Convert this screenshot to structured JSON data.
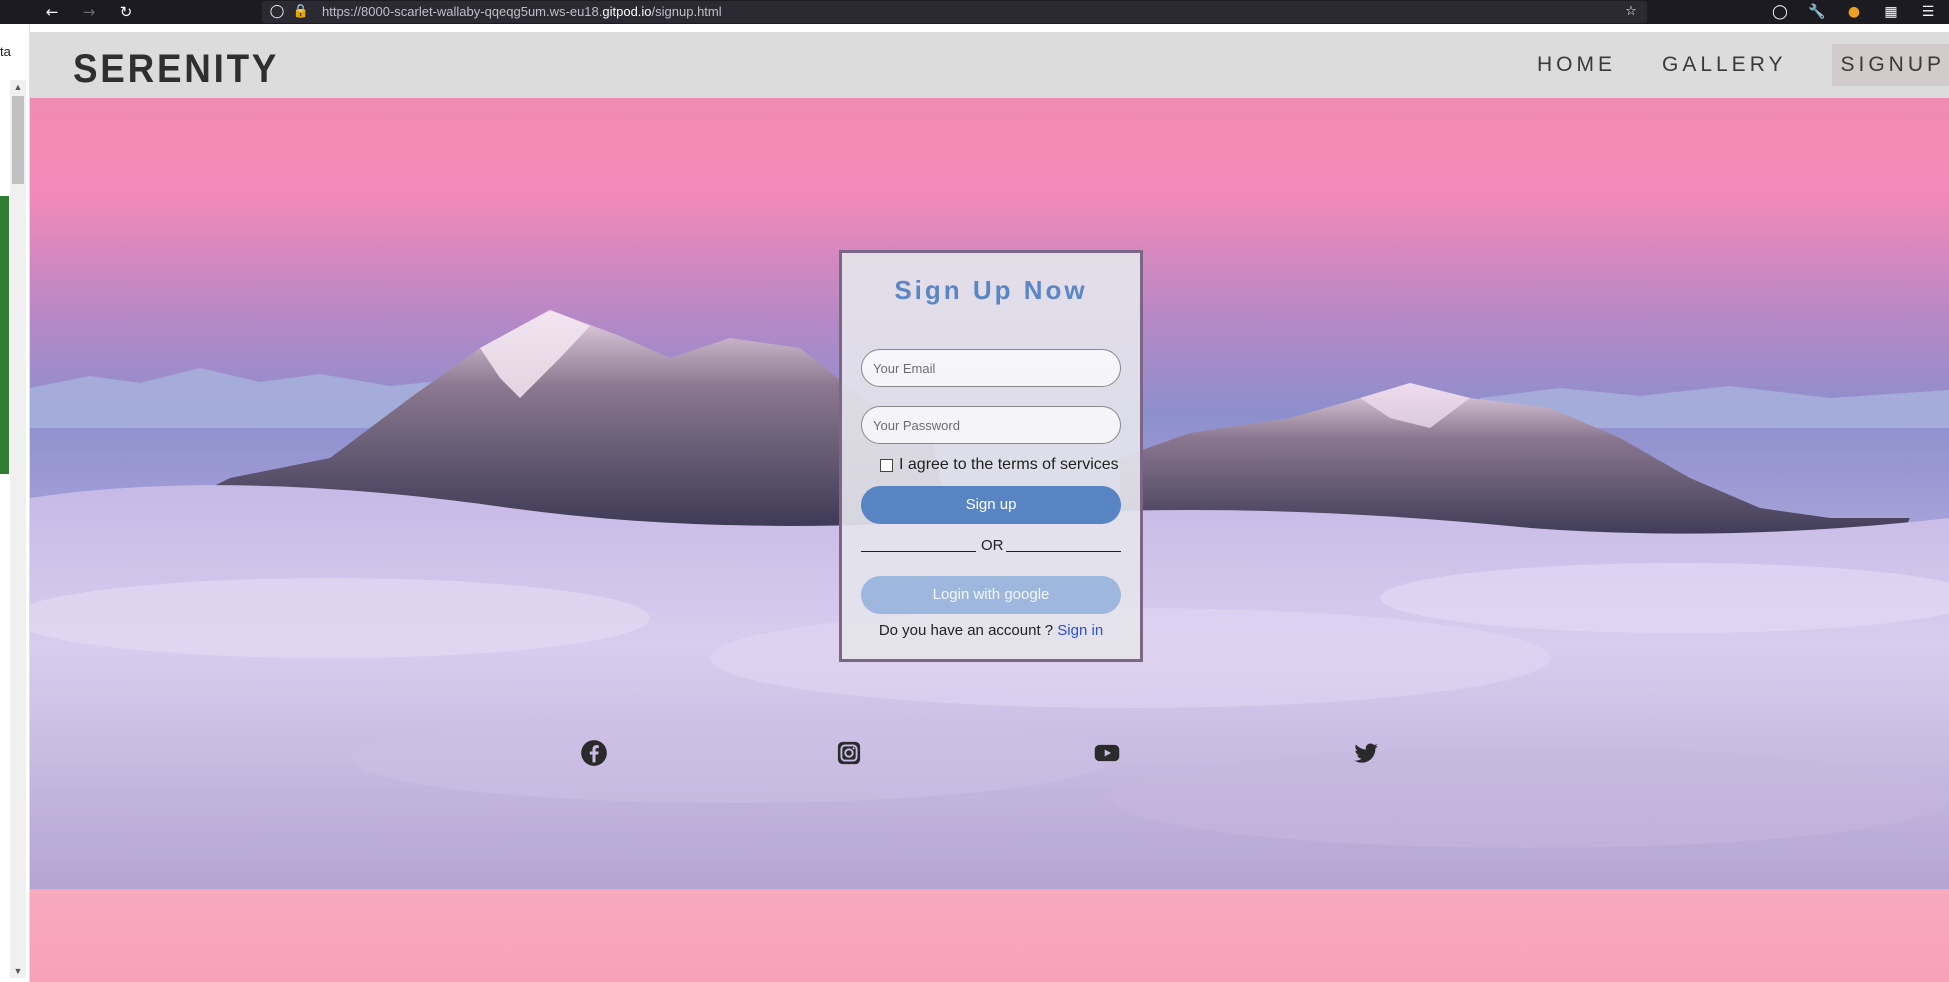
{
  "browser": {
    "url_prefix": "https://8000-scarlet-wallaby-qqeqg5um.ws-eu18.",
    "url_domain": "gitpod.io",
    "url_path": "/signup.html"
  },
  "left_strip": {
    "cut_text": "ta"
  },
  "site": {
    "logo": "SERENITY",
    "nav": {
      "home": "HOME",
      "gallery": "GALLERY",
      "signup": "SIGNUP"
    }
  },
  "signup": {
    "title": "Sign Up Now",
    "email_placeholder": "Your Email",
    "password_placeholder": "Your Password",
    "terms_label": "I agree to the terms of services",
    "signup_button": "Sign up",
    "or_text": "OR",
    "google_button": "Login with google",
    "account_question": "Do you have an account ? ",
    "signin_link": "Sign in"
  },
  "social": [
    "facebook-icon",
    "instagram-icon",
    "youtube-icon",
    "twitter-icon"
  ],
  "colors": {
    "accent": "#5884c4",
    "google_button": "#9db7de",
    "card_border": "#7c6685",
    "header_bg": "#dcdcdc"
  }
}
